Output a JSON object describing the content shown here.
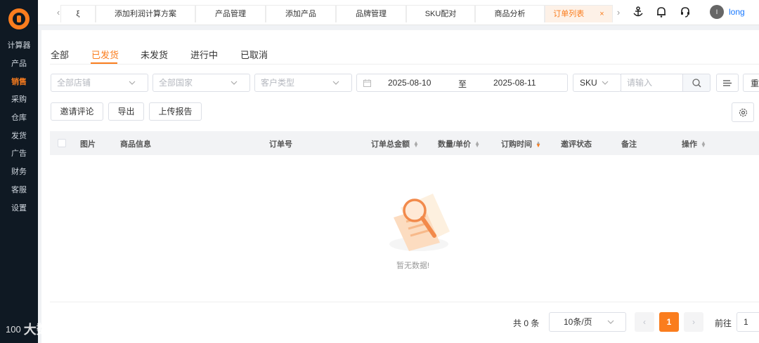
{
  "sidebar": {
    "items": [
      {
        "label": "计算器"
      },
      {
        "label": "产品"
      },
      {
        "label": "销售"
      },
      {
        "label": "采购"
      },
      {
        "label": "仓库"
      },
      {
        "label": "发货"
      },
      {
        "label": "广告"
      },
      {
        "label": "财务"
      },
      {
        "label": "客服"
      },
      {
        "label": "设置"
      }
    ],
    "active": "销售"
  },
  "topbar": {
    "tabs": [
      {
        "label": "ξ"
      },
      {
        "label": "添加利润计算方案"
      },
      {
        "label": "产品管理"
      },
      {
        "label": "添加产品"
      },
      {
        "label": "品牌管理"
      },
      {
        "label": "SKU配对"
      },
      {
        "label": "商品分析"
      },
      {
        "label": "订单列表"
      }
    ],
    "active_tab": "订单列表",
    "close_glyph": "×",
    "prev_arrow": "‹",
    "next_arrow": "›",
    "avatar_initial": "l",
    "username": "long"
  },
  "status_tabs": [
    {
      "label": "全部"
    },
    {
      "label": "已发货"
    },
    {
      "label": "未发货"
    },
    {
      "label": "进行中"
    },
    {
      "label": "已取消"
    }
  ],
  "active_status": "已发货",
  "filters": {
    "store_placeholder": "全部店铺",
    "country_placeholder": "全部国家",
    "customer_type_placeholder": "客户类型",
    "date_start": "2025-08-10",
    "date_sep": "至",
    "date_end": "2025-08-11",
    "search_field": "SKU",
    "search_placeholder": "请输入",
    "extra_glyph": "重"
  },
  "actions": {
    "invite_review": "邀请评论",
    "export": "导出",
    "upload_report": "上传报告"
  },
  "table": {
    "columns": [
      "图片",
      "商品信息",
      "订单号",
      "订单总金额",
      "数量/单价",
      "订购时间",
      "邀评状态",
      "备注",
      "操作"
    ],
    "empty_text": "暂无数据!"
  },
  "pagination": {
    "total": "共 0 条",
    "page_size": "10条/页",
    "current_page": "1",
    "goto_label": "前往",
    "goto_value": "1",
    "prev_glyph": "‹",
    "next_glyph": "›"
  },
  "watermark": {
    "text": "大数跨境",
    "logo_text": "100"
  },
  "colors": {
    "accent": "#fa7d1e",
    "sidebar_bg": "#0f1923",
    "link": "#1677ff"
  }
}
